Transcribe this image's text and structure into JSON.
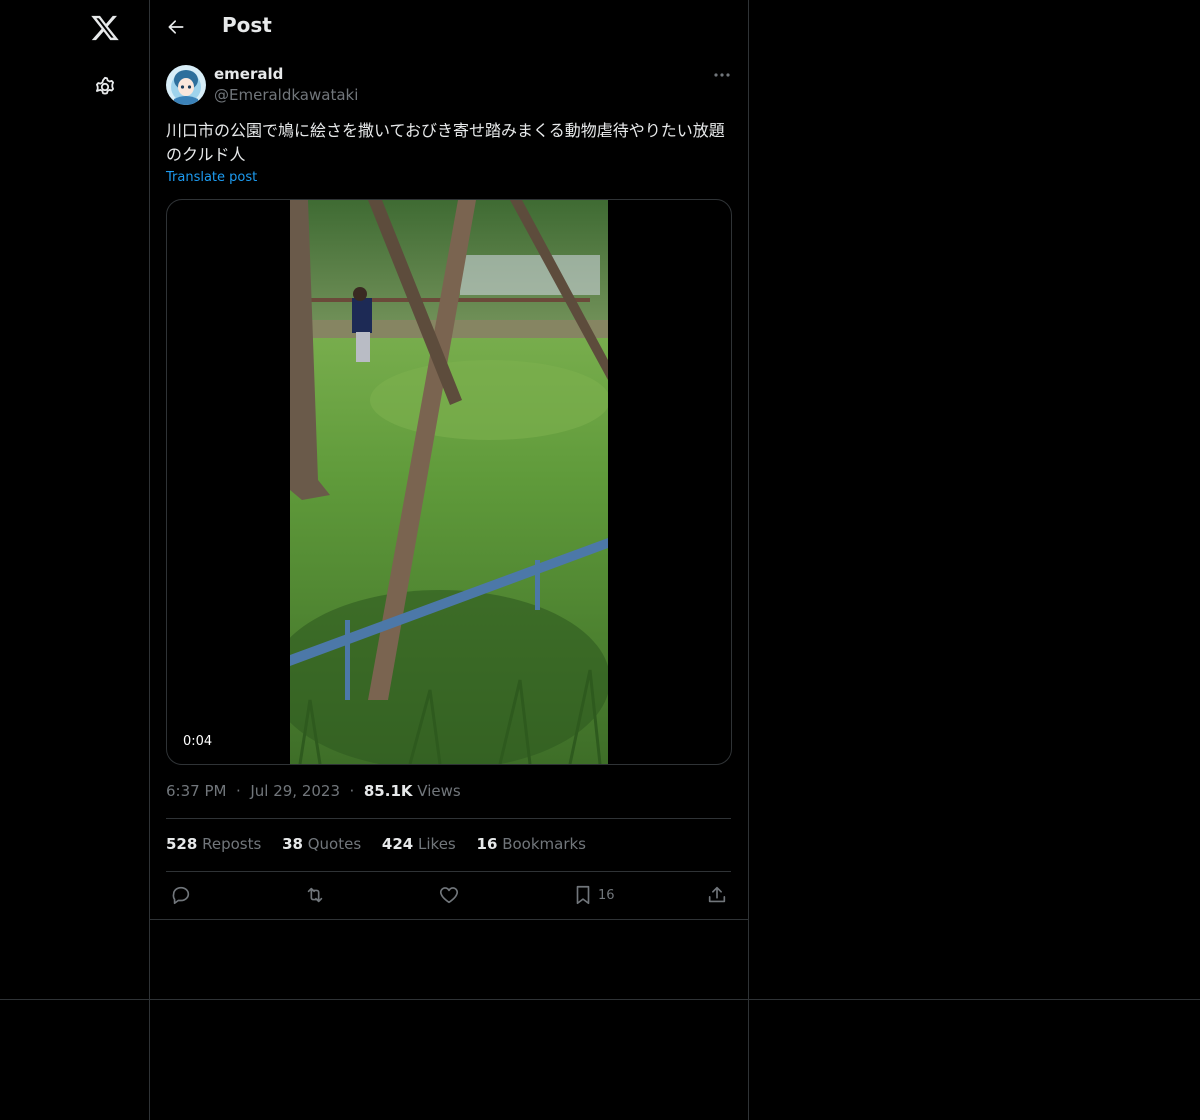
{
  "header": {
    "title": "Post"
  },
  "author": {
    "name": "emerald",
    "handle": "@Emeraldkawataki"
  },
  "post": {
    "text": "川口市の公園で鳩に絵さを撒いておびき寄せ踏みまくる動物虐待やりたい放題のクルド人",
    "translate_label": "Translate post",
    "video_duration": "0:04",
    "time": "6:37 PM",
    "date": "Jul 29, 2023",
    "views_count": "85.1K",
    "views_label": "Views"
  },
  "stats": {
    "reposts_count": "528",
    "reposts_label": "Reposts",
    "quotes_count": "38",
    "quotes_label": "Quotes",
    "likes_count": "424",
    "likes_label": "Likes",
    "bookmarks_count": "16",
    "bookmarks_label": "Bookmarks"
  },
  "actions": {
    "bookmark_count": "16"
  },
  "icons": [
    "x-logo-icon",
    "settings-gear-icon",
    "back-arrow-icon",
    "more-icon",
    "reply-icon",
    "repost-icon",
    "like-icon",
    "bookmark-icon",
    "share-icon"
  ],
  "colors": {
    "background": "#000000",
    "text": "#e7e9ea",
    "muted": "#71767b",
    "link": "#1d9bf0",
    "border": "#2f3336"
  }
}
